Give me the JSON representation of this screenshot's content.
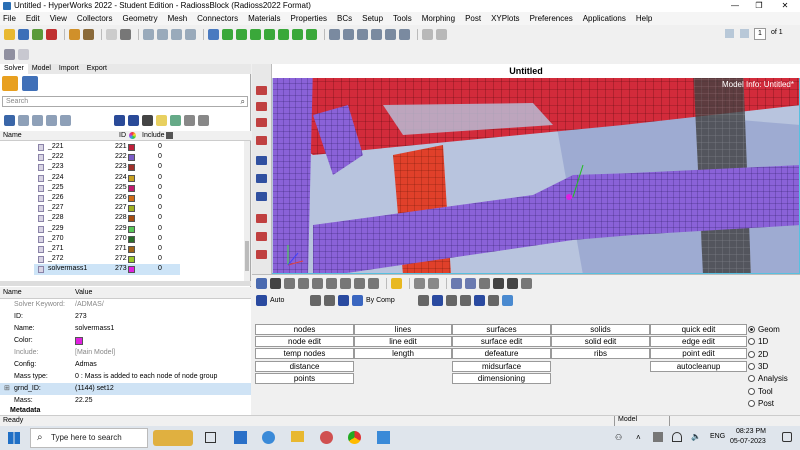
{
  "window": {
    "title": "Untitled - HyperWorks 2022 - Student Edition - RadiossBlock (Radioss2022 Format)",
    "min": "—",
    "max": "❐",
    "close": "✕"
  },
  "menu": [
    "File",
    "Edit",
    "View",
    "Collectors",
    "Geometry",
    "Mesh",
    "Connectors",
    "Materials",
    "Properties",
    "BCs",
    "Setup",
    "Tools",
    "Morphing",
    "Post",
    "XYPlots",
    "Preferences",
    "Applications",
    "Help"
  ],
  "page_counter": {
    "value": "1",
    "of": "of 1"
  },
  "tabs": [
    "Solver",
    "Model",
    "Import",
    "Export"
  ],
  "search": {
    "placeholder": "Search"
  },
  "columns": {
    "name": "Name",
    "id": "ID",
    "include": "Include"
  },
  "rows": [
    {
      "name": "_221",
      "id": "221",
      "color": "#c0203a",
      "include": "0"
    },
    {
      "name": "_222",
      "id": "222",
      "color": "#7b5cc7",
      "include": "0"
    },
    {
      "name": "_223",
      "id": "223",
      "color": "#a0302a",
      "include": "0"
    },
    {
      "name": "_224",
      "id": "224",
      "color": "#c8a020",
      "include": "0"
    },
    {
      "name": "_225",
      "id": "225",
      "color": "#c21b6e",
      "include": "0"
    },
    {
      "name": "_226",
      "id": "226",
      "color": "#d06b16",
      "include": "0"
    },
    {
      "name": "_227",
      "id": "227",
      "color": "#a0b020",
      "include": "0"
    },
    {
      "name": "_228",
      "id": "228",
      "color": "#a84d10",
      "include": "0"
    },
    {
      "name": "_229",
      "id": "229",
      "color": "#58c858",
      "include": "0"
    },
    {
      "name": "_270",
      "id": "270",
      "color": "#2a6e2a",
      "include": "0"
    },
    {
      "name": "_271",
      "id": "271",
      "color": "#a06418",
      "include": "0"
    },
    {
      "name": "_272",
      "id": "272",
      "color": "#9ac82a",
      "include": "0"
    },
    {
      "name": "solvermass1",
      "id": "273",
      "color": "#e020e0",
      "include": "0"
    }
  ],
  "props": {
    "header_name": "Name",
    "header_value": "Value",
    "items": [
      {
        "k": "Solver Keyword:",
        "v": "/ADMAS/"
      },
      {
        "k": "ID:",
        "v": "273"
      },
      {
        "k": "Name:",
        "v": "solvermass1"
      },
      {
        "k": "Color:",
        "v": ""
      },
      {
        "k": "Include:",
        "v": "[Main Model]"
      },
      {
        "k": "Config:",
        "v": "Admas"
      },
      {
        "k": "Mass type:",
        "v": "0 : Mass is added to each node of node group"
      },
      {
        "k": "grnd_ID:",
        "v": "(1144) set12"
      },
      {
        "k": "Mass:",
        "v": "22.25"
      },
      {
        "k": "Metadata",
        "v": ""
      }
    ]
  },
  "viewport": {
    "title": "Untitled",
    "model_info": "Model Info: Untitled*"
  },
  "viewbar": {
    "auto": "Auto",
    "by_comp": "By Comp"
  },
  "panel_buttons": [
    [
      "nodes",
      "lines",
      "surfaces",
      "solids",
      "quick edit"
    ],
    [
      "node edit",
      "line edit",
      "surface edit",
      "solid edit",
      "edge edit"
    ],
    [
      "temp nodes",
      "length",
      "defeature",
      "ribs",
      "point edit"
    ],
    [
      "distance",
      "",
      "midsurface",
      "",
      "autocleanup"
    ],
    [
      "points",
      "",
      "dimensioning",
      "",
      ""
    ]
  ],
  "radios": [
    "Geom",
    "1D",
    "2D",
    "3D",
    "Analysis",
    "Tool",
    "Post"
  ],
  "status": {
    "left": "Ready",
    "model": "Model"
  },
  "taskbar": {
    "search": "Type here to search",
    "time": "08:23 PM",
    "date": "05-07-2023",
    "lang": "ENG"
  }
}
